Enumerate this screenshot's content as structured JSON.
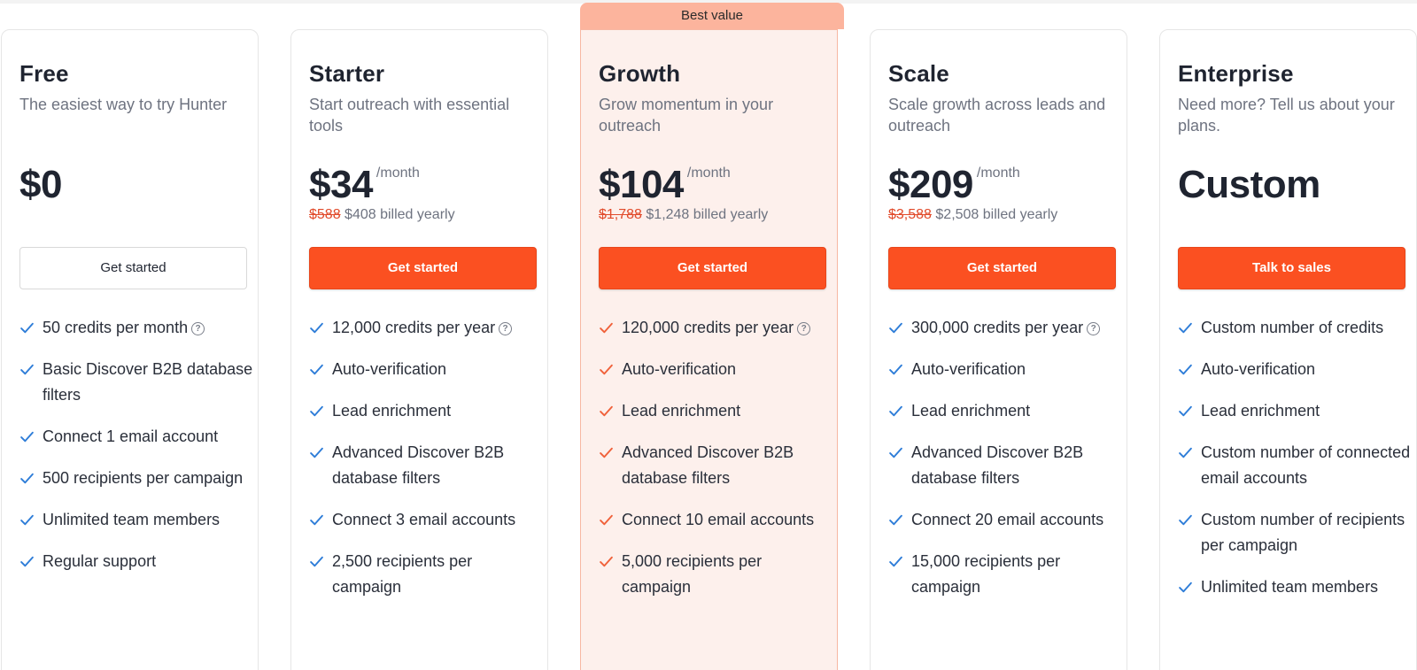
{
  "ribbon": "Best value",
  "plans": [
    {
      "name": "Free",
      "tagline": "The easiest way to try Hunter",
      "price": "$0",
      "per": "",
      "old_price": "",
      "billed": "",
      "button": "Get started",
      "features": [
        {
          "text": "50 credits per month",
          "help": true
        },
        {
          "text": "Basic Discover B2B database filters",
          "help": false
        },
        {
          "text": "Connect 1 email account",
          "help": false
        },
        {
          "text": "500 recipients per campaign",
          "help": false
        },
        {
          "text": "Unlimited team members",
          "help": false
        },
        {
          "text": "Regular support",
          "help": false
        }
      ]
    },
    {
      "name": "Starter",
      "tagline": "Start outreach with essential tools",
      "price": "$34",
      "per": "/month",
      "old_price": "$588",
      "billed": "$408 billed yearly",
      "button": "Get started",
      "features": [
        {
          "text": "12,000 credits per year",
          "help": true
        },
        {
          "text": "Auto-verification",
          "help": false
        },
        {
          "text": "Lead enrichment",
          "help": false
        },
        {
          "text": "Advanced Discover B2B database filters",
          "help": false
        },
        {
          "text": "Connect 3 email accounts",
          "help": false
        },
        {
          "text": "2,500 recipients per campaign",
          "help": false
        }
      ]
    },
    {
      "name": "Growth",
      "tagline": "Grow momentum in your outreach",
      "price": "$104",
      "per": "/month",
      "old_price": "$1,788",
      "billed": "$1,248 billed yearly",
      "button": "Get started",
      "features": [
        {
          "text": "120,000 credits per year",
          "help": true
        },
        {
          "text": "Auto-verification",
          "help": false
        },
        {
          "text": "Lead enrichment",
          "help": false
        },
        {
          "text": "Advanced Discover B2B database filters",
          "help": false
        },
        {
          "text": "Connect 10 email accounts",
          "help": false
        },
        {
          "text": "5,000 recipients per campaign",
          "help": false
        }
      ]
    },
    {
      "name": "Scale",
      "tagline": "Scale growth across leads and outreach",
      "price": "$209",
      "per": "/month",
      "old_price": "$3,588",
      "billed": "$2,508 billed yearly",
      "button": "Get started",
      "features": [
        {
          "text": "300,000 credits per year",
          "help": true
        },
        {
          "text": "Auto-verification",
          "help": false
        },
        {
          "text": "Lead enrichment",
          "help": false
        },
        {
          "text": "Advanced Discover B2B database filters",
          "help": false
        },
        {
          "text": "Connect 20 email accounts",
          "help": false
        },
        {
          "text": "15,000 recipients per campaign",
          "help": false
        }
      ]
    },
    {
      "name": "Enterprise",
      "tagline": "Need more? Tell us about your plans.",
      "price": "Custom",
      "per": "",
      "old_price": "",
      "billed": "",
      "button": "Talk to sales",
      "features": [
        {
          "text": "Custom number of credits",
          "help": false
        },
        {
          "text": "Auto-verification",
          "help": false
        },
        {
          "text": "Lead enrichment",
          "help": false
        },
        {
          "text": "Custom number of connected email accounts",
          "help": false
        },
        {
          "text": "Custom number of recipients per campaign",
          "help": false
        },
        {
          "text": "Unlimited team members",
          "help": false
        }
      ]
    }
  ],
  "colors": {
    "accent": "#fb5021",
    "check_blue": "#2e7dd8",
    "check_orange": "#f0613a",
    "featured_bg": "#fdf0ec",
    "ribbon_bg": "#fcb49d",
    "strike_red": "#e14a2a"
  },
  "icons": {
    "check": "check-icon",
    "help": "question-circle-icon"
  }
}
